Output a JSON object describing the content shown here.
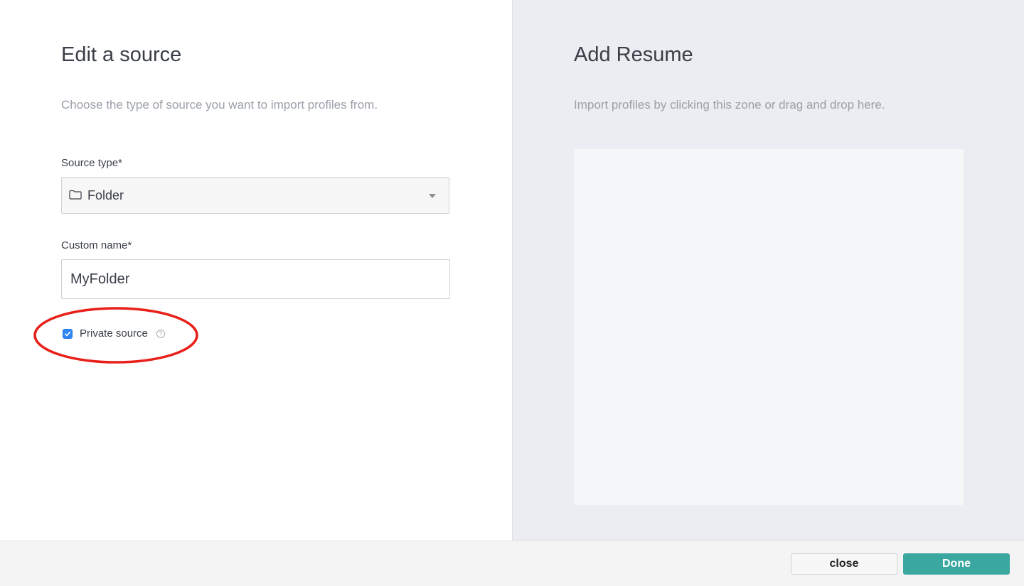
{
  "edit_source": {
    "title": "Edit a source",
    "subtitle": "Choose the type of source you want to import profiles from.",
    "source_type": {
      "label": "Source type*",
      "value": "Folder",
      "icon": "folder-icon"
    },
    "custom_name": {
      "label": "Custom name*",
      "value": "MyFolder"
    },
    "private_source": {
      "label": "Private source",
      "checked": true,
      "help_glyph": "?"
    },
    "annotation_color": "#e8201a"
  },
  "add_resume": {
    "title": "Add Resume",
    "subtitle": "Import profiles by clicking this zone or drag and drop here."
  },
  "footer": {
    "close_label": "close",
    "done_label": "Done",
    "done_color": "#3aa8a0"
  }
}
